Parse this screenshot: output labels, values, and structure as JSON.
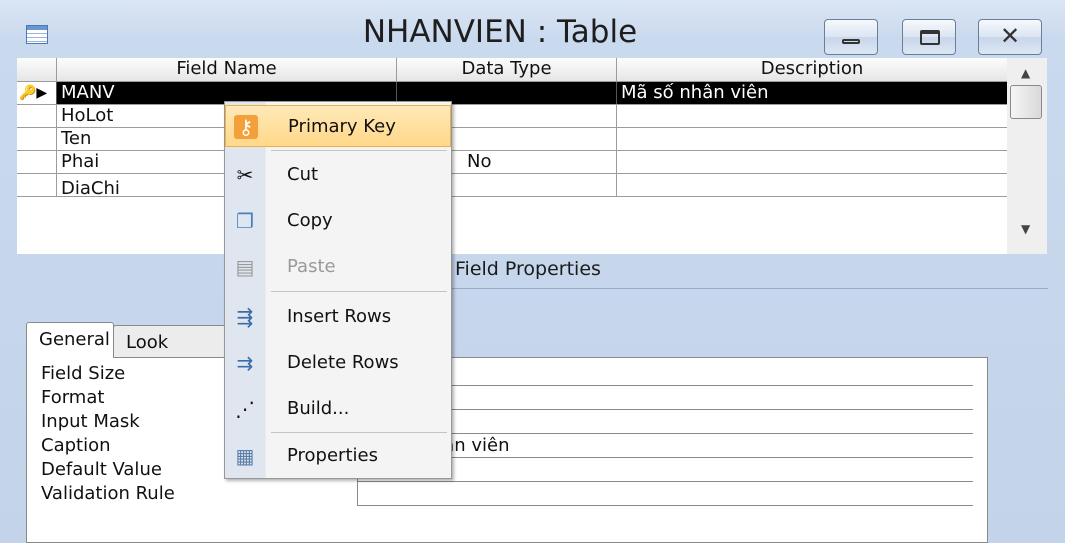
{
  "window": {
    "title": "NHANVIEN : Table"
  },
  "grid": {
    "headers": [
      "Field Name",
      "Data Type",
      "Description"
    ],
    "rows": [
      {
        "field": "MANV",
        "type": "",
        "desc": "Mã số nhân viên"
      },
      {
        "field": "HoLot",
        "type": "",
        "desc": ""
      },
      {
        "field": "Ten",
        "type": "",
        "desc": ""
      },
      {
        "field": "Phai",
        "type": "No",
        "desc": ""
      },
      {
        "field": "DiaChi",
        "type": "",
        "desc": ""
      }
    ]
  },
  "field_properties": {
    "label": "Field Properties",
    "tabs": [
      "General",
      "Look"
    ],
    "rows": [
      {
        "label": "Field Size",
        "value": ""
      },
      {
        "label": "Format",
        "value": ""
      },
      {
        "label": "Input Mask",
        "value": ""
      },
      {
        "label": "Caption",
        "value": "Mã số nhân viên"
      },
      {
        "label": "Default Value",
        "value": ""
      },
      {
        "label": "Validation Rule",
        "value": ""
      }
    ]
  },
  "context_menu": {
    "items": [
      {
        "label": "Primary Key",
        "icon": "key-icon",
        "highlighted": true
      },
      {
        "label": "Cut",
        "icon": "scissors-icon"
      },
      {
        "label": "Copy",
        "icon": "copy-icon"
      },
      {
        "label": "Paste",
        "icon": "paste-icon",
        "disabled": true
      },
      {
        "label": "Insert Rows",
        "icon": "insert-rows-icon"
      },
      {
        "label": "Delete Rows",
        "icon": "delete-rows-icon"
      },
      {
        "label": "Build...",
        "icon": "build-wand-icon"
      },
      {
        "label": "Properties",
        "icon": "properties-icon"
      }
    ]
  }
}
